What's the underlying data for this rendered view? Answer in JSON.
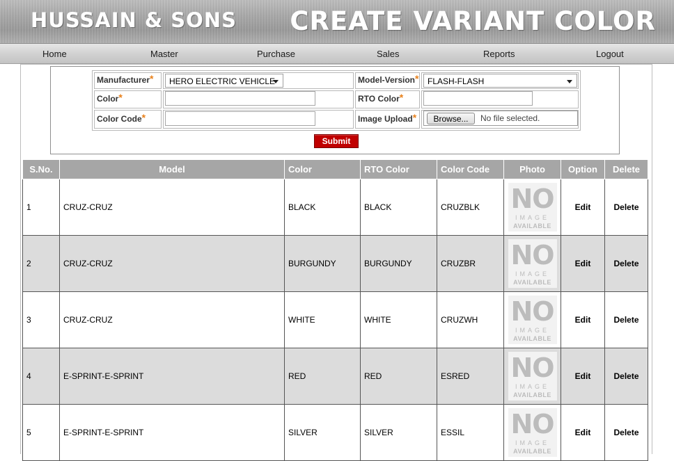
{
  "header": {
    "brand": "HUSSAIN & SONS",
    "title": "CREATE VARIANT COLOR"
  },
  "nav": {
    "items": [
      "Home",
      "Master",
      "Purchase",
      "Sales",
      "Reports",
      "Logout"
    ]
  },
  "form": {
    "manufacturer_label": "Manufacturer",
    "manufacturer_value": "HERO ELECTRIC VEHICLE",
    "model_version_label": "Model-Version",
    "model_version_value": "FLASH-FLASH",
    "color_label": "Color",
    "color_value": "",
    "rto_color_label": "RTO Color",
    "rto_color_value": "",
    "color_code_label": "Color Code",
    "color_code_value": "",
    "image_upload_label": "Image Upload",
    "browse_label": "Browse...",
    "no_file_text": "No file selected.",
    "required_mark": "*",
    "submit_label": "Submit"
  },
  "table": {
    "headers": [
      "S.No.",
      "Model",
      "Color",
      "RTO Color",
      "Color Code",
      "Photo",
      "Option",
      "Delete"
    ],
    "no_image": {
      "line1": "NO",
      "line2": "IMAGE",
      "line3": "AVAILABLE"
    },
    "rows": [
      {
        "sno": "1",
        "model": "CRUZ-CRUZ",
        "color": "BLACK",
        "rto_color": "BLACK",
        "color_code": "CRUZBLK",
        "option": "Edit",
        "delete": "Delete"
      },
      {
        "sno": "2",
        "model": "CRUZ-CRUZ",
        "color": "BURGUNDY",
        "rto_color": "BURGUNDY",
        "color_code": "CRUZBR",
        "option": "Edit",
        "delete": "Delete"
      },
      {
        "sno": "3",
        "model": "CRUZ-CRUZ",
        "color": "WHITE",
        "rto_color": "WHITE",
        "color_code": "CRUZWH",
        "option": "Edit",
        "delete": "Delete"
      },
      {
        "sno": "4",
        "model": "E-SPRINT-E-SPRINT",
        "color": "RED",
        "rto_color": "RED",
        "color_code": "ESRED",
        "option": "Edit",
        "delete": "Delete"
      },
      {
        "sno": "5",
        "model": "E-SPRINT-E-SPRINT",
        "color": "SILVER",
        "rto_color": "SILVER",
        "color_code": "ESSIL",
        "option": "Edit",
        "delete": "Delete"
      }
    ]
  },
  "colors": {
    "header_bg": "#a6a6a6",
    "submit_bg": "#c00000",
    "required": "#e8801a",
    "alt_row": "#dcdcdc"
  }
}
